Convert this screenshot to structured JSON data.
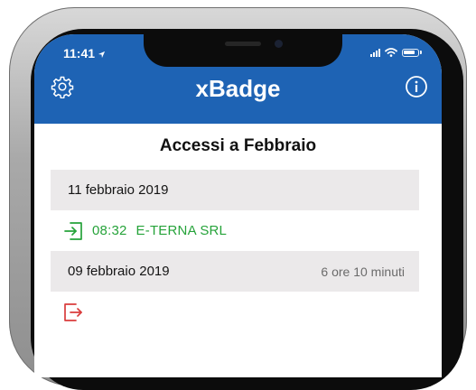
{
  "status_bar": {
    "time": "11:41"
  },
  "header": {
    "title": "xBadge"
  },
  "main": {
    "month_title": "Accessi a Febbraio",
    "days": [
      {
        "date": "11 febbraio 2019",
        "total": "",
        "entries": [
          {
            "kind": "entrance",
            "time": "08:32",
            "company": "E-TERNA SRL"
          }
        ]
      },
      {
        "date": "09 febbraio 2019",
        "total": "6 ore 10 minuti",
        "entries": [
          {
            "kind": "exit",
            "time": "",
            "company": ""
          }
        ]
      }
    ]
  },
  "colors": {
    "header_bg": "#1e63b4",
    "entrance": "#26a33a",
    "exit": "#d93c3c",
    "day_header_bg": "#ebe9ea"
  },
  "icons": {
    "settings": "gear-icon",
    "info": "info-icon",
    "entrance": "login-arrow-icon",
    "exit": "logout-arrow-icon"
  }
}
